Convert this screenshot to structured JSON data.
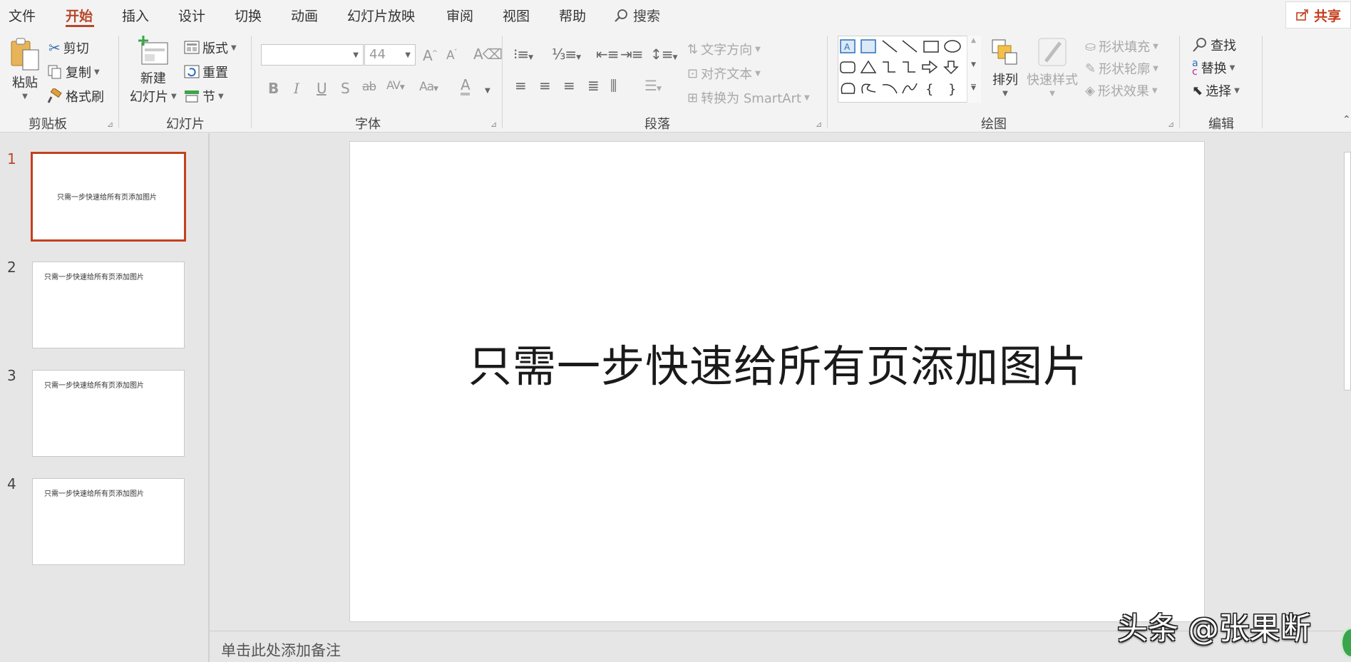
{
  "menu": {
    "tabs": [
      "文件",
      "开始",
      "插入",
      "设计",
      "切换",
      "动画",
      "幻灯片放映",
      "审阅",
      "视图",
      "帮助"
    ],
    "active_tab": "开始",
    "search_label": "搜索",
    "share_label": "共享"
  },
  "ribbon": {
    "clipboard": {
      "label": "剪贴板",
      "paste": "粘贴",
      "cut": "剪切",
      "copy": "复制",
      "format_painter": "格式刷"
    },
    "slides": {
      "label": "幻灯片",
      "new_slide_line1": "新建",
      "new_slide_line2": "幻灯片",
      "layout": "版式",
      "reset": "重置",
      "section": "节"
    },
    "font": {
      "label": "字体",
      "font_name": "",
      "font_size": "44"
    },
    "paragraph": {
      "label": "段落",
      "text_direction": "文字方向",
      "align_text": "对齐文本",
      "convert_smartart": "转换为 SmartArt"
    },
    "drawing": {
      "label": "绘图",
      "arrange": "排列",
      "quick_styles": "快速样式",
      "shape_fill": "形状填充",
      "shape_outline": "形状轮廓",
      "shape_effects": "形状效果"
    },
    "editing": {
      "label": "编辑",
      "find": "查找",
      "replace": "替换",
      "select": "选择"
    }
  },
  "slides": [
    {
      "number": "1",
      "text": "只需一步快速给所有页添加图片",
      "selected": true
    },
    {
      "number": "2",
      "text": "只需一步快速给所有页添加图片",
      "selected": false
    },
    {
      "number": "3",
      "text": "只需一步快速给所有页添加图片",
      "selected": false
    },
    {
      "number": "4",
      "text": "只需一步快速给所有页添加图片",
      "selected": false
    }
  ],
  "main_slide": {
    "title": "只需一步快速给所有页添加图片"
  },
  "notes": {
    "placeholder": "单击此处添加备注"
  },
  "watermark": "头条 @张果断",
  "colors": {
    "accent": "#b7472a",
    "selection_border": "#c4401e",
    "ribbon_bg": "#f3f3f3",
    "workspace_bg": "#e6e6e6"
  }
}
